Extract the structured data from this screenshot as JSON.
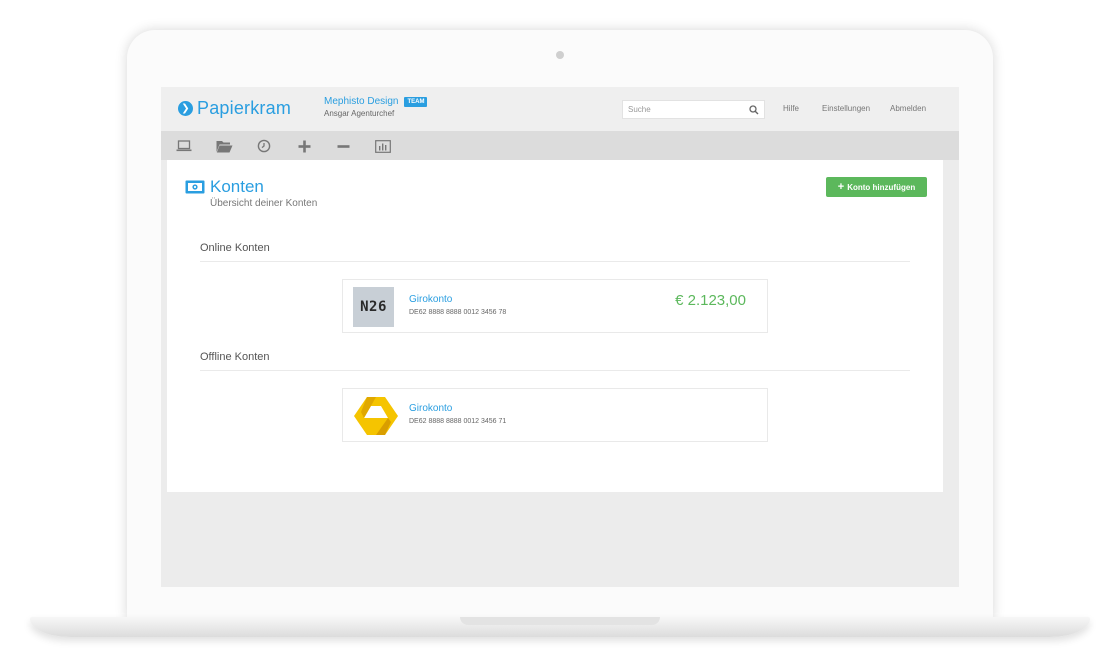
{
  "app": {
    "brand": "Papierkram",
    "company": "Mephisto Design",
    "team_badge": "TEAM",
    "user": "Ansgar Agenturchef"
  },
  "search": {
    "placeholder": "Suche"
  },
  "nav_links": [
    "Hilfe",
    "Einstellungen",
    "Abmelden"
  ],
  "toolbar": {
    "icons": [
      "laptop-icon",
      "folder-icon",
      "clock-icon",
      "plus-icon",
      "minus-icon",
      "chart-icon"
    ]
  },
  "page": {
    "title": "Konten",
    "subtitle": "Übersicht deiner Konten",
    "add_button": "Konto hinzufügen"
  },
  "sections": [
    {
      "heading": "Online Konten",
      "accounts": [
        {
          "logo": "N26",
          "logo_icon": "n26-logo-icon",
          "name": "Girokonto",
          "iban": "DE62 8888 8888 0012 3456 78",
          "balance": "€ 2.123,00"
        }
      ]
    },
    {
      "heading": "Offline Konten",
      "accounts": [
        {
          "logo_icon": "commerzbank-logo-icon",
          "name": "Girokonto",
          "iban": "DE62 8888 8888 0012 3456 71",
          "balance": ""
        }
      ]
    }
  ],
  "colors": {
    "brand_blue": "#2a9ee0",
    "success_green": "#5cb85c",
    "logo_yellow": "#f5c400"
  }
}
